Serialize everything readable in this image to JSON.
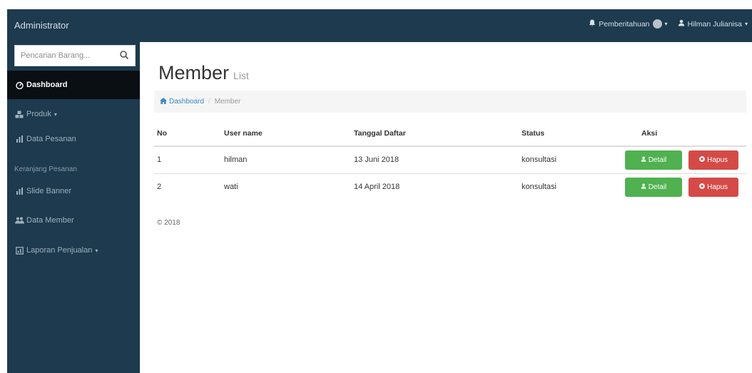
{
  "header": {
    "brand": "Administrator",
    "notifications_label": "Pemberitahuan",
    "user_label": "Hilman Julianisa"
  },
  "sidebar": {
    "search_placeholder": "Pencarian Barang...",
    "items": [
      {
        "label": "Dashboard"
      },
      {
        "label": "Produk"
      },
      {
        "label": "Data Pesanan"
      },
      {
        "label": "Keranjang Pesanan"
      },
      {
        "label": "Slide Banner"
      },
      {
        "label": "Data Member"
      },
      {
        "label": "Laporan Penjualan"
      }
    ]
  },
  "main": {
    "title": "Member",
    "subtitle": "List",
    "breadcrumb": {
      "home": "Dashboard",
      "current": "Member"
    },
    "table": {
      "headers": [
        "No",
        "User name",
        "Tanggal Daftar",
        "Status",
        "Aksi"
      ],
      "rows": [
        {
          "no": "1",
          "username": "hilman",
          "date": "13 Juni 2018",
          "status": "konsultasi"
        },
        {
          "no": "2",
          "username": "wati",
          "date": "14 April 2018",
          "status": "konsultasi"
        }
      ],
      "detail_label": "Detail",
      "hapus_label": "Hapus"
    },
    "footer": "© 2018"
  },
  "colors": {
    "topbar": "#1d3a4e",
    "sidebar": "#1d3a4e",
    "active_item": "#0a0f14",
    "detail_button": "#4fb14f",
    "hapus_button": "#d44a47",
    "link": "#3b8bc6"
  }
}
